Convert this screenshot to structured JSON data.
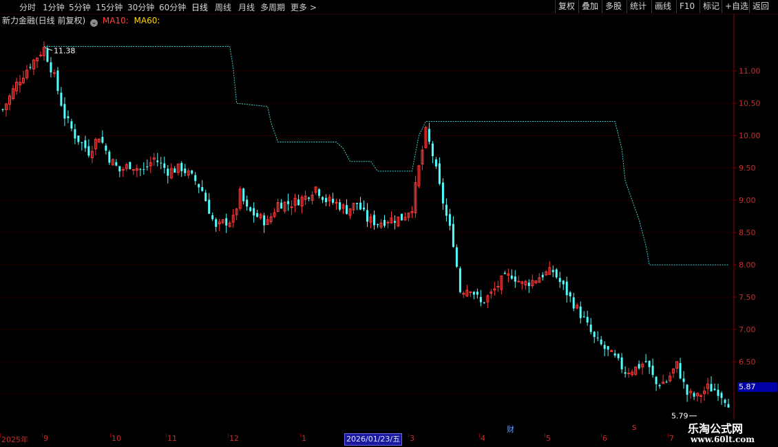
{
  "toolbar": {
    "periods": [
      "分时",
      "1分钟",
      "5分钟",
      "15分钟",
      "30分钟",
      "60分钟",
      "日线",
      "周线",
      "月线",
      "多周期",
      "更多 >"
    ],
    "active_period": "日线",
    "right_buttons": [
      "复权",
      "叠加",
      "多股",
      "统计",
      "画线",
      "F10",
      "标记",
      "+自选",
      "返回"
    ]
  },
  "legend": {
    "title": "新力金融(日线 前复权)",
    "ma10": "MA10:",
    "ma60": "MA60:",
    "colors": {
      "title": "#d8d8d8",
      "ma10": "#ff4040",
      "ma60": "#ffd700"
    }
  },
  "chart": {
    "high_label": "11.38",
    "low_label": "5.79",
    "current_price": "5.87",
    "y_ticks": [
      "11.00",
      "10.50",
      "10.00",
      "9.50",
      "9.00",
      "8.50",
      "8.00",
      "7.50",
      "7.00",
      "6.50"
    ],
    "x_labels": [
      "2025年",
      "9",
      "10",
      "11",
      "12",
      "1",
      "3",
      "4",
      "5",
      "6",
      "7"
    ],
    "cursor_date": "2026/01/23/五",
    "event_marks": {
      "finance": "财",
      "s": "S"
    },
    "colors": {
      "up": "#ff3a3a",
      "down": "#54ffff",
      "grid": "#5a0000",
      "line": "#38d0d0",
      "axis": "#8a0000"
    }
  },
  "chart_data": {
    "type": "candlestick",
    "ylim": [
      5.5,
      11.8
    ],
    "y_ticks": [
      11.0,
      10.5,
      10.0,
      9.5,
      9.0,
      8.5,
      8.0,
      7.5,
      7.0,
      6.5
    ],
    "annotations": [
      {
        "text": "11.38",
        "price": 11.38
      },
      {
        "text": "5.79",
        "price": 5.79
      }
    ],
    "close_path": [
      [
        0,
        10.4
      ],
      [
        4,
        10.8
      ],
      [
        8,
        11.1
      ],
      [
        12,
        11.35
      ],
      [
        15,
        10.9
      ],
      [
        18,
        10.3
      ],
      [
        21,
        10.0
      ],
      [
        25,
        9.75
      ],
      [
        28,
        10.0
      ],
      [
        31,
        9.65
      ],
      [
        34,
        9.45
      ],
      [
        37,
        9.55
      ],
      [
        41,
        9.45
      ],
      [
        44,
        9.65
      ],
      [
        48,
        9.45
      ],
      [
        52,
        9.5
      ],
      [
        56,
        9.3
      ],
      [
        58,
        9.15
      ],
      [
        60,
        8.85
      ],
      [
        62,
        8.55
      ],
      [
        64,
        8.65
      ],
      [
        67,
        8.7
      ],
      [
        69,
        9.1
      ],
      [
        71,
        8.85
      ],
      [
        74,
        8.75
      ],
      [
        77,
        8.65
      ],
      [
        80,
        8.95
      ],
      [
        84,
        8.95
      ],
      [
        88,
        9.05
      ],
      [
        91,
        9.2
      ],
      [
        94,
        9.0
      ],
      [
        97,
        8.95
      ],
      [
        100,
        8.85
      ],
      [
        103,
        8.95
      ],
      [
        106,
        8.7
      ],
      [
        109,
        8.65
      ],
      [
        112,
        8.7
      ],
      [
        116,
        8.72
      ],
      [
        119,
        8.9
      ],
      [
        121,
        9.5
      ],
      [
        123,
        10.05
      ],
      [
        125,
        9.7
      ],
      [
        127,
        9.2
      ],
      [
        129,
        8.75
      ],
      [
        131,
        8.35
      ],
      [
        133,
        7.6
      ],
      [
        136,
        7.65
      ],
      [
        139,
        7.4
      ],
      [
        142,
        7.55
      ],
      [
        145,
        7.75
      ],
      [
        148,
        7.85
      ],
      [
        151,
        7.7
      ],
      [
        154,
        7.75
      ],
      [
        157,
        7.85
      ],
      [
        160,
        7.9
      ],
      [
        163,
        7.65
      ],
      [
        166,
        7.4
      ],
      [
        169,
        7.15
      ],
      [
        172,
        6.85
      ],
      [
        175,
        6.7
      ],
      [
        178,
        6.55
      ],
      [
        181,
        6.35
      ],
      [
        184,
        6.4
      ],
      [
        187,
        6.5
      ],
      [
        190,
        6.15
      ],
      [
        193,
        6.2
      ],
      [
        196,
        6.45
      ],
      [
        199,
        6.0
      ],
      [
        202,
        5.95
      ],
      [
        205,
        6.1
      ],
      [
        208,
        6.05
      ],
      [
        211,
        5.87
      ]
    ],
    "stop_line": [
      [
        12,
        11.38
      ],
      [
        66,
        11.38
      ],
      [
        67,
        11.05
      ],
      [
        68,
        10.5
      ],
      [
        77,
        10.45
      ],
      [
        78,
        10.2
      ],
      [
        80,
        9.9
      ],
      [
        97,
        9.9
      ],
      [
        99,
        9.8
      ],
      [
        101,
        9.6
      ],
      [
        107,
        9.6
      ],
      [
        109,
        9.45
      ],
      [
        119,
        9.45
      ],
      [
        121,
        10.0
      ],
      [
        123,
        10.22
      ],
      [
        178,
        10.22
      ],
      [
        180,
        9.8
      ],
      [
        181,
        9.3
      ],
      [
        183,
        9.0
      ],
      [
        185,
        8.7
      ],
      [
        187,
        8.3
      ],
      [
        188,
        8.0
      ],
      [
        211,
        8.0
      ]
    ]
  }
}
